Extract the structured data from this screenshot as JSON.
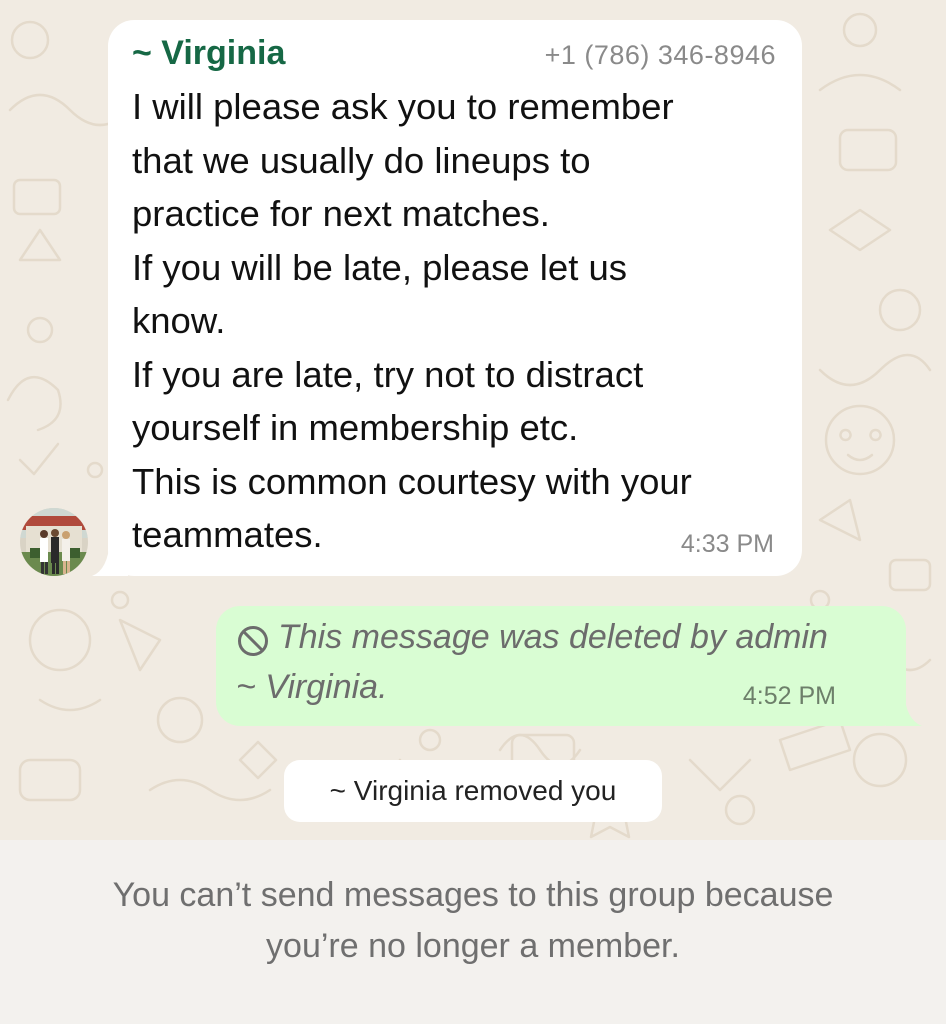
{
  "chat": {
    "incoming_message": {
      "sender_name": "~ Virginia",
      "sender_phone": "+1 (786) 346-8946",
      "lines": [
        "I will please ask you to remember",
        "that we usually do lineups to",
        "practice for next matches.",
        "If you will be late, please let us",
        "know.",
        "If you are late, try not to distract",
        "yourself in membership etc.",
        "This is common courtesy with your",
        "teammates."
      ],
      "time": "4:33 PM"
    },
    "outgoing_message": {
      "deleted_line1": "This message was deleted by admin",
      "deleted_line2": "~ Virginia.",
      "time": "4:52 PM"
    },
    "system_notice": "~ Virginia removed you"
  },
  "footer": {
    "line1": "You can’t send messages to this group because",
    "line2": "you’re no longer a member."
  },
  "colors": {
    "sender_name": "#166845",
    "outgoing_bubble": "#d9fdd3",
    "chat_background": "#f1ebe2"
  },
  "icons": {
    "deleted": "prohibited-circle-icon",
    "avatar": "group-photo-avatar"
  }
}
